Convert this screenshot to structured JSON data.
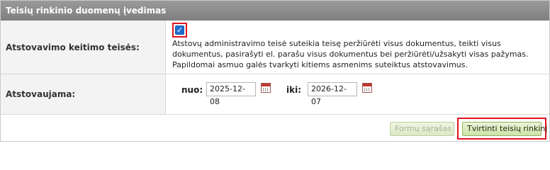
{
  "panel": {
    "title": "Teisių rinkinio duomenų įvedimas"
  },
  "rows": {
    "rights": {
      "label": "Atstovavimo keitimo teisės:",
      "checked": true,
      "description": "Atstovų administravimo teisė suteikia teisę peržiūrėti visus dokumentus, teikti visus dokumentus, pasirašyti el. parašu visus dokumentus bei peržiūrėti/užsakyti visas pažymas. Papildomai asmuo galės tvarkyti kitiems asmenims suteiktus atstovavimus."
    },
    "period": {
      "label": "Atstovaujama:",
      "from_label": "nuo:",
      "from_value": "2025-12-08",
      "to_label": "iki:",
      "to_value": "2026-12-07"
    }
  },
  "footer": {
    "forms_list_label": "Formų sąrašas",
    "confirm_label": "Tvirtinti teisių rinkinį"
  },
  "colors": {
    "title_bar": "#8a8a8a",
    "highlight": "#e0151f",
    "checkbox": "#1f6fd1",
    "button_green": "#cfe3a9"
  },
  "icons": {
    "checkbox": "checkmark-icon",
    "calendar": "calendar-icon"
  }
}
